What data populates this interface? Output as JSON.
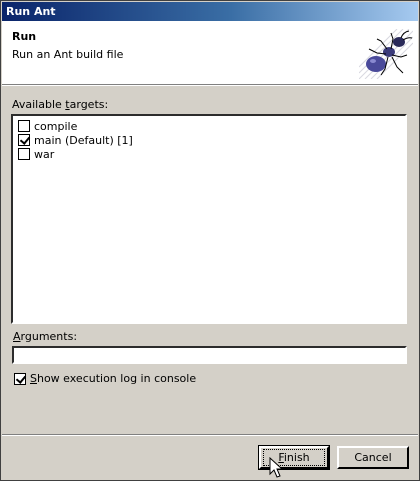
{
  "window": {
    "title": "Run Ant"
  },
  "banner": {
    "title": "Run",
    "description": "Run an Ant build file",
    "logo_icon": "ant-icon"
  },
  "targets": {
    "label_pre": "Available ",
    "label_mnemonic": "t",
    "label_post": "argets:",
    "items": [
      {
        "label": "compile",
        "checked": false
      },
      {
        "label": "main (Default) [1]",
        "checked": true
      },
      {
        "label": "war",
        "checked": false
      }
    ]
  },
  "arguments": {
    "label_mnemonic": "A",
    "label_post": "rguments:",
    "value": ""
  },
  "show_log": {
    "checked": true,
    "label_mnemonic": "S",
    "label_post": "how execution log in console"
  },
  "buttons": {
    "finish_mnemonic": "F",
    "finish_post": "inish",
    "cancel": "Cancel"
  },
  "colors": {
    "title_gradient_start": "#0a246a",
    "title_gradient_end": "#a6caf0",
    "dialog_bg": "#d4d0c8"
  }
}
